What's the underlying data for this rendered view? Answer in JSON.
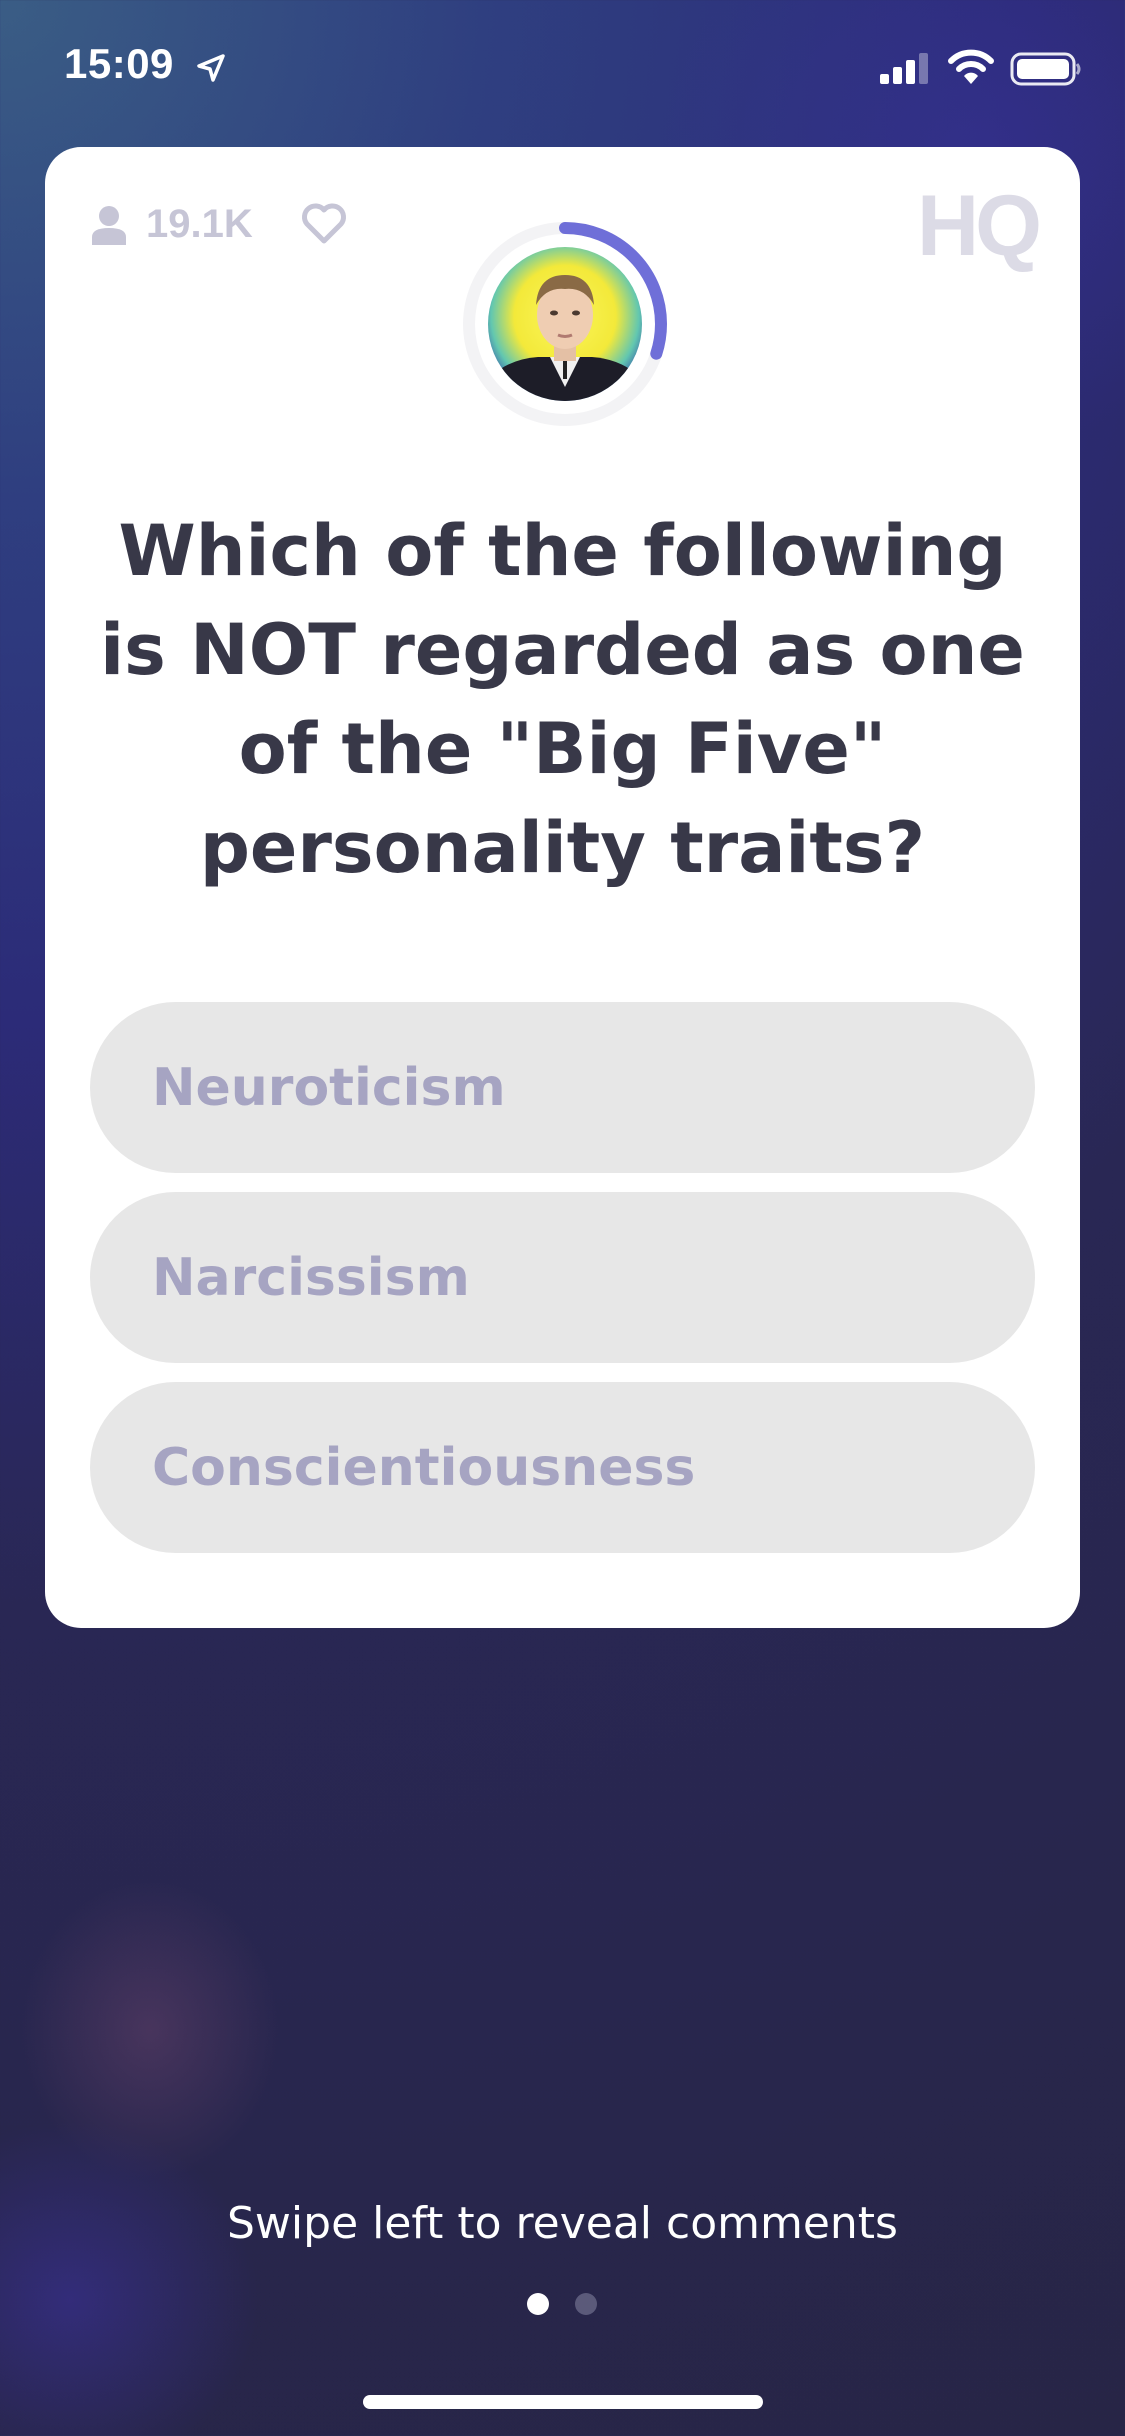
{
  "status_bar": {
    "time": "15:09",
    "icons": [
      "location-arrow-icon",
      "cellular-signal-icon",
      "wifi-icon",
      "battery-icon"
    ]
  },
  "card": {
    "viewer_count": "19.1K",
    "logo": "HQ",
    "timer_progress": 0.3,
    "question": "Which of the following is NOT regarded as one of the \"Big Five\" personality traits?",
    "answers": [
      {
        "label": "Neuroticism"
      },
      {
        "label": "Narcissism"
      },
      {
        "label": "Conscientiousness"
      }
    ]
  },
  "footer": {
    "hint": "Swipe left to reveal comments",
    "page_index": 0,
    "page_count": 2
  },
  "colors": {
    "timer_arc": "#6f6fd8",
    "answer_bg": "#e7e7e7",
    "answer_text": "#a6a4c2",
    "question_text": "#383848"
  }
}
